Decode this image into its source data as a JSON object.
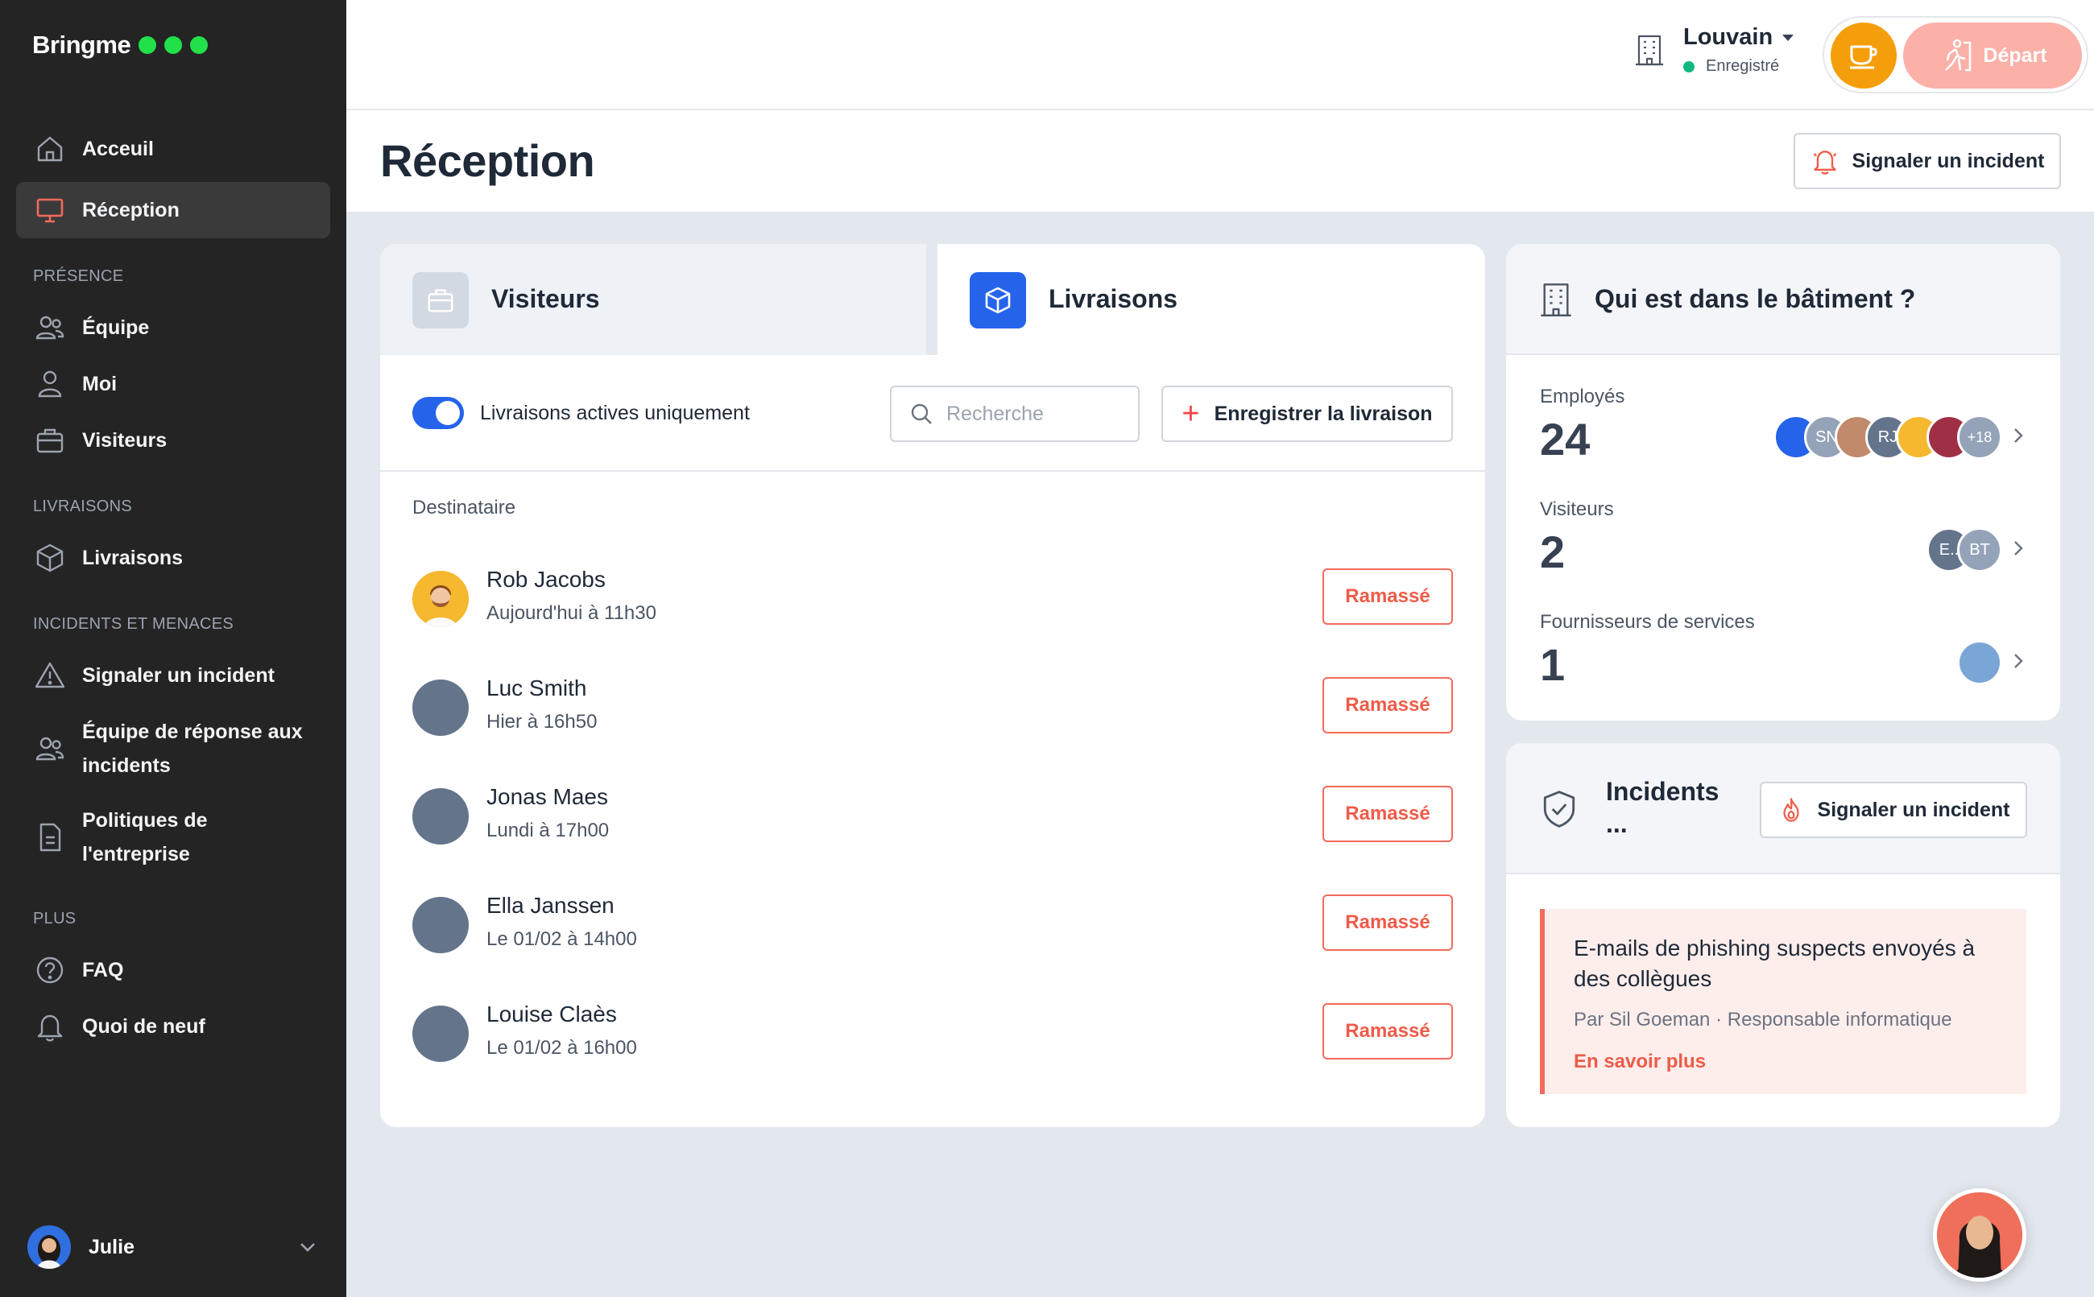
{
  "brand": {
    "name": "Bringme"
  },
  "sidebar": {
    "nav": [
      {
        "label": "Acceuil"
      },
      {
        "label": "Réception"
      }
    ],
    "presence_label": "PRÉSENCE",
    "presence": [
      {
        "label": "Équipe"
      },
      {
        "label": "Moi"
      },
      {
        "label": "Visiteurs"
      }
    ],
    "livraisons_label": "LIVRAISONS",
    "livraisons": [
      {
        "label": "Livraisons"
      }
    ],
    "incidents_label": "INCIDENTS ET MENACES",
    "incidents": [
      {
        "label": "Signaler un incident"
      },
      {
        "label_1": "Équipe de réponse aux",
        "label_2": "incidents"
      },
      {
        "label_1": "Politiques de",
        "label_2": "l'entreprise"
      }
    ],
    "plus_label": "PLUS",
    "plus": [
      {
        "label": "FAQ"
      },
      {
        "label": "Quoi de neuf"
      }
    ],
    "user": {
      "name": "Julie"
    }
  },
  "header": {
    "location": "Louvain",
    "location_status": "Enregistré",
    "depart_label": "Départ"
  },
  "page": {
    "title": "Réception",
    "report_button": "Signaler un incident"
  },
  "deliveries": {
    "tabs": [
      {
        "label": "Visiteurs"
      },
      {
        "label": "Livraisons"
      }
    ],
    "toggle_label": "Livraisons actives uniquement",
    "search_placeholder": "Recherche",
    "register_button": "Enregistrer la livraison",
    "column_header": "Destinataire",
    "rows": [
      {
        "name": "Rob Jacobs",
        "time": "Aujourd'hui à 11h30",
        "action": "Ramassé"
      },
      {
        "name": "Luc Smith",
        "time": " Hier à 16h50",
        "action": "Ramassé"
      },
      {
        "name": "Jonas Maes",
        "time": "Lundi à 17h00",
        "action": "Ramassé"
      },
      {
        "name": "Ella Janssen",
        "time": "Le 01/02 à 14h00",
        "action": "Ramassé"
      },
      {
        "name": "Louise Claès",
        "time": "Le 01/02 à 16h00",
        "action": "Ramassé"
      }
    ]
  },
  "building": {
    "title": "Qui est dans le bâtiment ?",
    "stats": [
      {
        "label": "Employés",
        "count": "24",
        "avatars": [
          "",
          "SN",
          "",
          "RJ",
          "",
          "",
          "+18"
        ]
      },
      {
        "label": "Visiteurs",
        "count": "2",
        "avatars": [
          "E..",
          "BT"
        ]
      },
      {
        "label": "Fournisseurs de services",
        "count": "1",
        "avatars": [
          ""
        ]
      }
    ]
  },
  "incidents": {
    "title": "Incidents",
    "title_more": "...",
    "report_button": "Signaler un incident",
    "item": {
      "headline": "E-mails de phishing suspects envoyés à des collègues",
      "byline": "Par Sil Goeman · Responsable informatique",
      "link": "En savoir plus"
    }
  },
  "colors": {
    "sidebar_bg": "#242424",
    "accent_blue": "#2563eb",
    "accent_red": "#ef5b48",
    "coffee": "#f59e0b",
    "depart": "#fbb0a8",
    "status_green": "#10b981",
    "brand_dots": "#22e04a"
  }
}
